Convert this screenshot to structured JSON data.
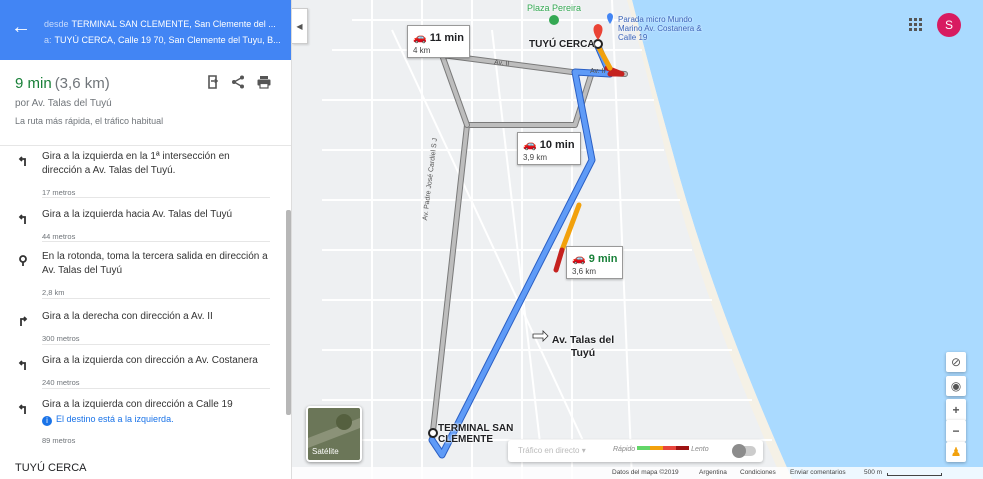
{
  "route": {
    "from_label": "desde",
    "from_value": "TERMINAL SAN CLEMENTE, San Clemente del ...",
    "to_label": "a:",
    "to_value": "TUYÚ CERCA, Calle 19 70, San Clemente del Tuyu, B..."
  },
  "summary": {
    "time": "9 min",
    "distance": "(3,6 km)",
    "via": "por Av. Talas del Tuyú",
    "note": "La ruta más rápida, el tráfico habitual"
  },
  "steps": [
    {
      "text": "Gira a la izquierda en la 1ª intersección en dirección a Av. Talas del Tuyú.",
      "distance": "17 metros",
      "icon": "turn-left-icon"
    },
    {
      "text": "Gira a la izquierda hacia Av. Talas del Tuyú",
      "distance": "44 metros",
      "icon": "turn-left-icon"
    },
    {
      "text": "En la rotonda, toma la tercera salida en dirección a Av. Talas del Tuyú",
      "distance": "2,8 km",
      "icon": "roundabout-icon"
    },
    {
      "text": "Gira a la derecha con dirección a Av. II",
      "distance": "300 metros",
      "icon": "turn-right-icon"
    },
    {
      "text": "Gira a la izquierda con dirección a Av. Costanera",
      "distance": "240 metros",
      "icon": "turn-left-icon"
    },
    {
      "text": "Gira a la izquierda con dirección a Calle 19",
      "info": "El destino está a la izquierda.",
      "distance": "89 metros",
      "icon": "turn-left-icon"
    }
  ],
  "destination_title": "TUYÚ CERCA",
  "map": {
    "alt_routes": [
      {
        "time": "11 min",
        "distance": "4 km"
      },
      {
        "time": "10 min",
        "distance": "3,9 km"
      }
    ],
    "main_route": {
      "time": "9 min",
      "distance": "3,6 km"
    },
    "labels": {
      "plaza": "Plaza Pereira",
      "poi": "Parada micro Mundo Marino Av. Costanera & Calle 19",
      "destination": "TUYÚ CERCA",
      "origin": "TERMINAL SAN CLEMENTE",
      "street_main": "Av. Talas del Tuyú",
      "street_side": "Av. Padre José Cardiel S J",
      "street_ii_1": "Av. II",
      "street_ii_2": "Av. II"
    },
    "satellite_label": "Satélite",
    "traffic_select": "Tráfico en directo",
    "traffic_fast": "Rápido",
    "traffic_slow": "Lento",
    "avatar_letter": "S",
    "colors": {
      "route": "#4a8af4",
      "alt_route": "#a7a7a7",
      "slow": "#c5221f",
      "medium": "#f2a10c",
      "header": "#4285f4",
      "fast_time": "#188038"
    }
  },
  "footer": {
    "data": "Datos del mapa ©2019",
    "country": "Argentina",
    "terms": "Condiciones",
    "feedback": "Enviar comentarios",
    "scale": "500 m"
  }
}
